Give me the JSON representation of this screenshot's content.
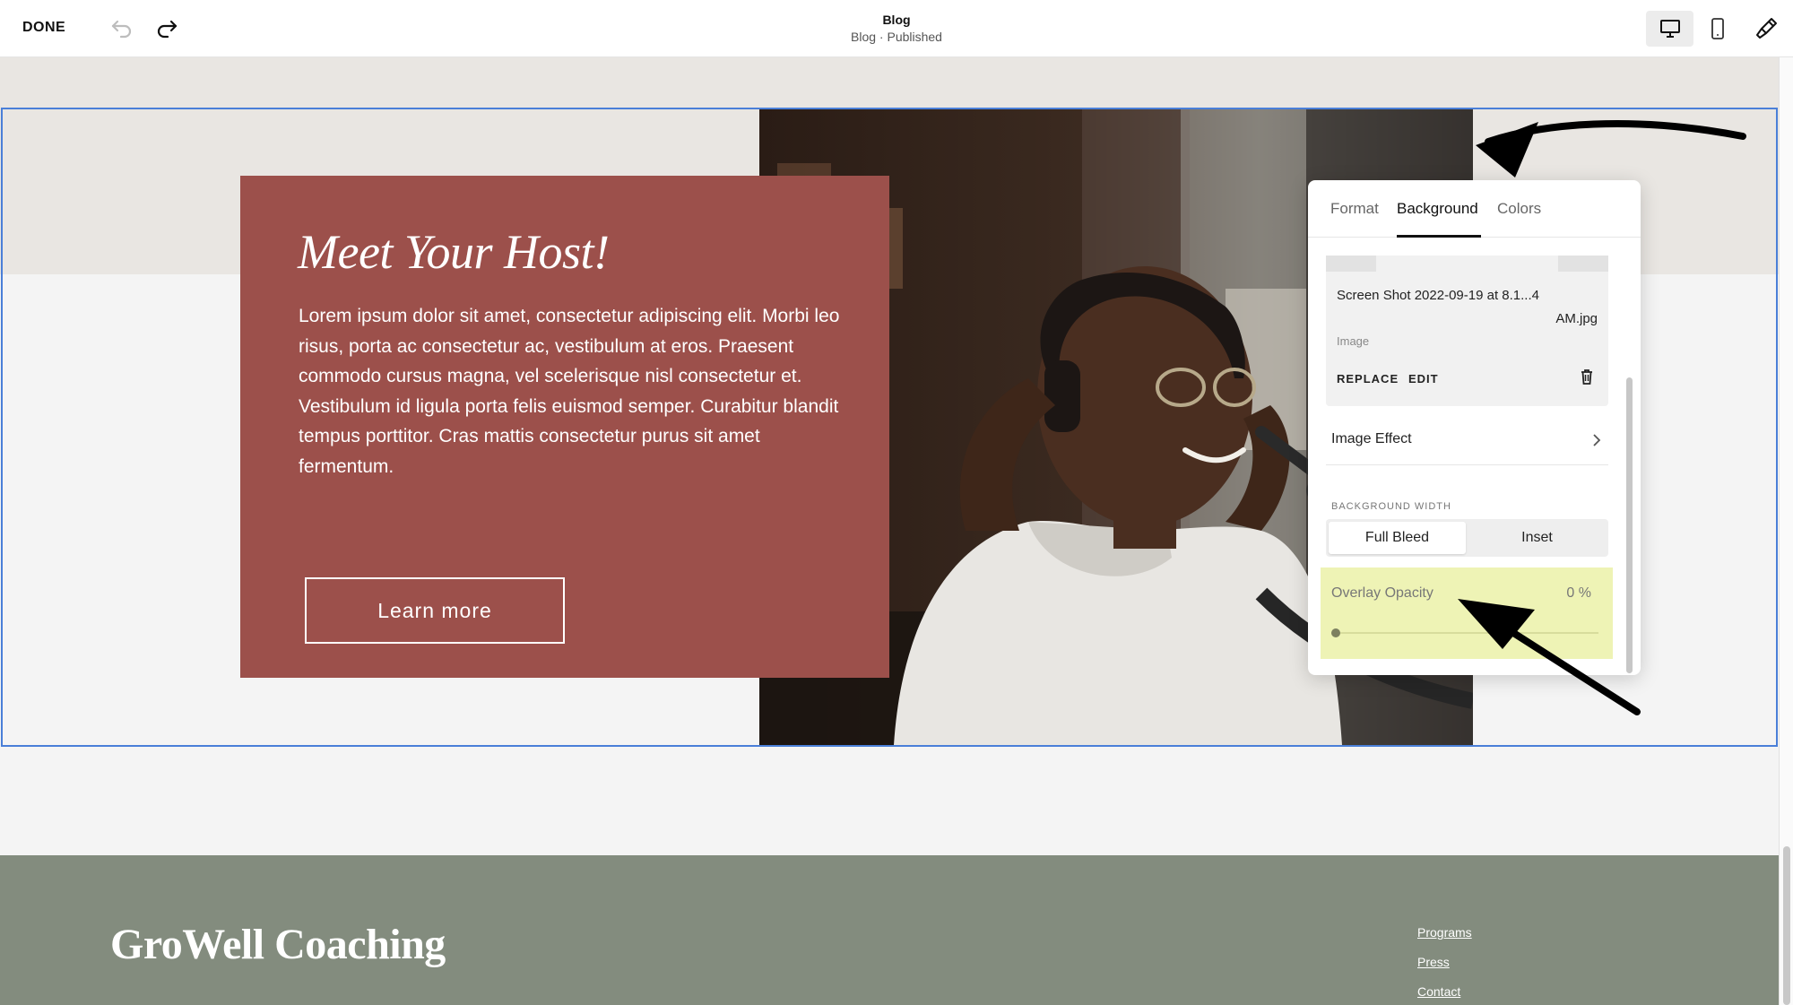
{
  "toolbar": {
    "done_label": "DONE",
    "page_title": "Blog",
    "page_subtitle": "Blog · Published"
  },
  "hero": {
    "title": "Meet Your Host!",
    "body": "Lorem ipsum dolor sit amet, consectetur adipiscing elit. Morbi leo risus, porta ac consectetur ac, vestibulum at eros. Praesent commodo cursus magna, vel scelerisque nisl consectetur et. Vestibulum id ligula porta felis euismod semper. Curabitur blandit tempus porttitor. Cras mattis consectetur purus sit amet fermentum.",
    "button_label": "Learn more",
    "card_color": "#9c504b"
  },
  "panel": {
    "tabs": [
      {
        "label": "Format"
      },
      {
        "label": "Background"
      },
      {
        "label": "Colors"
      }
    ],
    "active_tab": "Background",
    "image": {
      "name_line1": "Screen Shot 2022-09-19 at 8.1...4",
      "name_line2": "AM.jpg",
      "type_label": "Image",
      "replace_label": "REPLACE",
      "edit_label": "EDIT"
    },
    "image_effect_label": "Image Effect",
    "background_width": {
      "label": "BACKGROUND WIDTH",
      "options": [
        "Full Bleed",
        "Inset"
      ],
      "selected": "Full Bleed"
    },
    "overlay_opacity": {
      "label": "Overlay Opacity",
      "value_text": "0 %",
      "value": 0,
      "highlight_color": "#eef3b5"
    }
  },
  "footer": {
    "logo": "GroWell Coaching",
    "links": [
      "Programs",
      "Press",
      "Contact"
    ],
    "background_color": "#838c7e"
  },
  "accent": {
    "selection_outline": "#4a7fd8"
  }
}
